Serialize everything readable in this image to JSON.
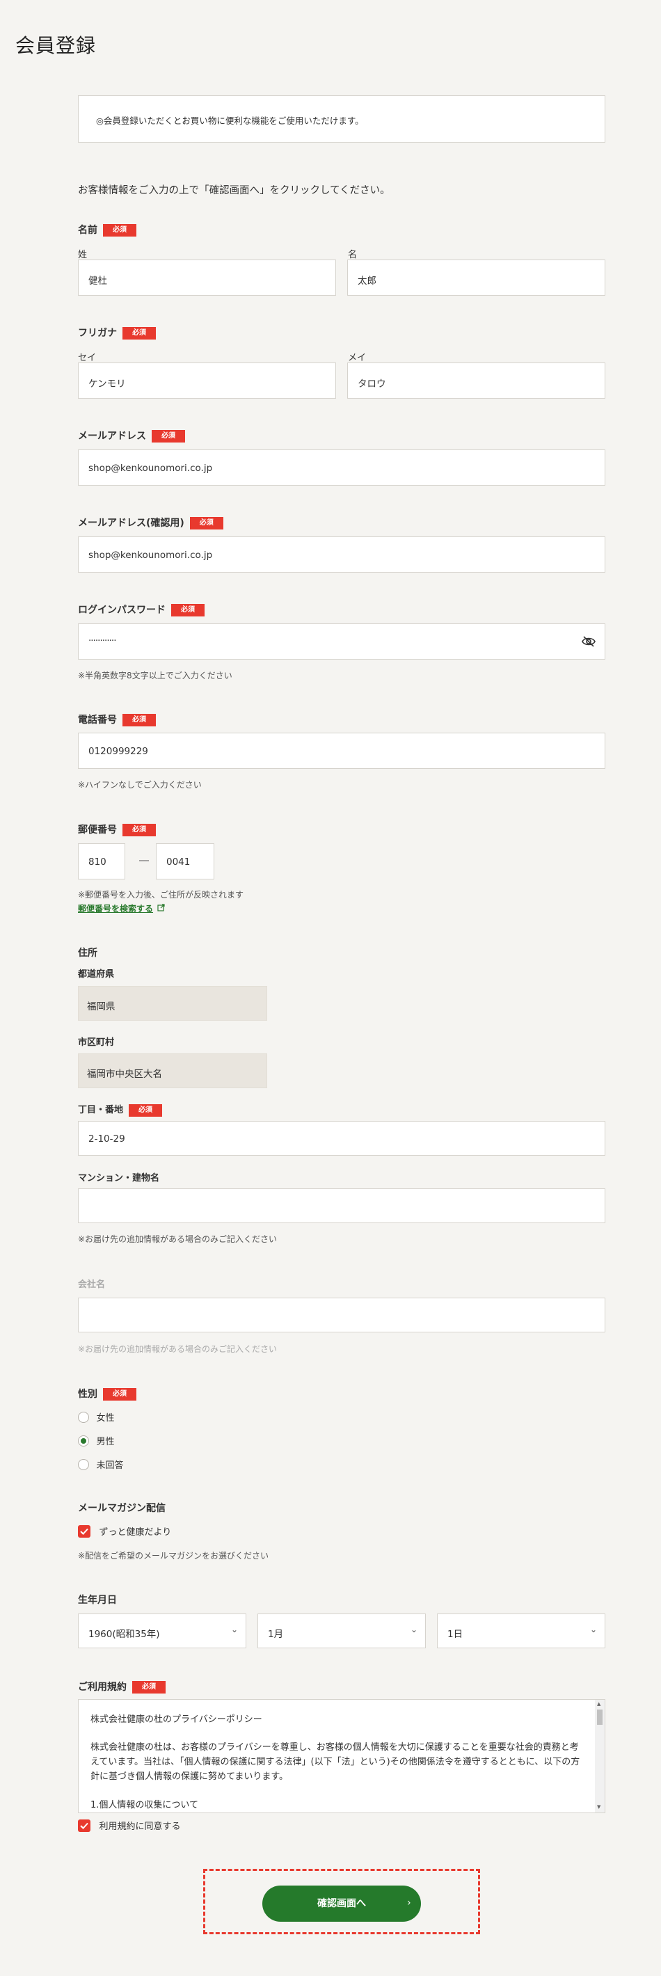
{
  "header": {
    "title": "会員登録"
  },
  "notice": {
    "text": "◎会員登録いただくとお買い物に便利な機能をご使用いただけます。"
  },
  "intro": "お客様情報をご入力の上で「確認画面へ」をクリックしてください。",
  "required_badge": "必須",
  "name": {
    "label": "名前",
    "last_label": "姓",
    "last_value": "健杜",
    "first_label": "名",
    "first_value": "太郎"
  },
  "furigana": {
    "label": "フリガナ",
    "last_label": "セイ",
    "last_value": "ケンモリ",
    "first_label": "メイ",
    "first_value": "タロウ"
  },
  "email": {
    "label": "メールアドレス",
    "value": "shop@kenkounomori.co.jp"
  },
  "email_confirm": {
    "label": "メールアドレス(確認用)",
    "value": "shop@kenkounomori.co.jp"
  },
  "password": {
    "label": "ログインパスワード",
    "value": "············",
    "note": "※半角英数字8文字以上でご入力ください",
    "toggle_icon": "eye-slash-icon"
  },
  "phone": {
    "label": "電話番号",
    "value": "0120999229",
    "note": "※ハイフンなしでご入力ください"
  },
  "postal": {
    "label": "郵便番号",
    "first": "810",
    "dash": "―",
    "second": "0041",
    "note": "※郵便番号を入力後、ご住所が反映されます",
    "search_link": "郵便番号を検索する",
    "link_icon": "external-link-icon"
  },
  "address": {
    "label": "住所",
    "prefecture_label": "都道府県",
    "prefecture_value": "福岡県",
    "city_label": "市区町村",
    "city_value": "福岡市中央区大名",
    "street_label": "丁目・番地",
    "street_value": "2-10-29",
    "building_label": "マンション・建物名",
    "building_value": "",
    "building_note": "※お届け先の追加情報がある場合のみご記入ください"
  },
  "company": {
    "label": "会社名",
    "value": "",
    "note": "※お届け先の追加情報がある場合のみご記入ください"
  },
  "gender": {
    "label": "性別",
    "options": [
      "女性",
      "男性",
      "未回答"
    ],
    "selected": "男性"
  },
  "newsletter": {
    "label": "メールマガジン配信",
    "option": "ずっと健康だより",
    "checked": true,
    "note": "※配信をご希望のメールマガジンをお選びください"
  },
  "birthday": {
    "label": "生年月日",
    "year": "1960(昭和35年)",
    "month": "1月",
    "day": "1日"
  },
  "terms": {
    "label": "ご利用規約",
    "title": "株式会社健康の杜のプライバシーポリシー",
    "body": "株式会社健康の杜は、お客様のプライバシーを尊重し、お客様の個人情報を大切に保護することを重要な社会的責務と考えています。当社は、「個人情報の保護に関する法律」(以下「法」という)その他関係法令を遵守するとともに、以下の方針に基づき個人情報の保護に努めてまいります。",
    "section": "1.個人情報の収集について",
    "agree_label": "利用規約に同意する",
    "agreed": true
  },
  "submit": {
    "label": "確認画面へ",
    "arrow": "›"
  },
  "colors": {
    "accent_green": "#257a2b",
    "required_red": "#e8392e",
    "background": "#f5f4f1"
  }
}
